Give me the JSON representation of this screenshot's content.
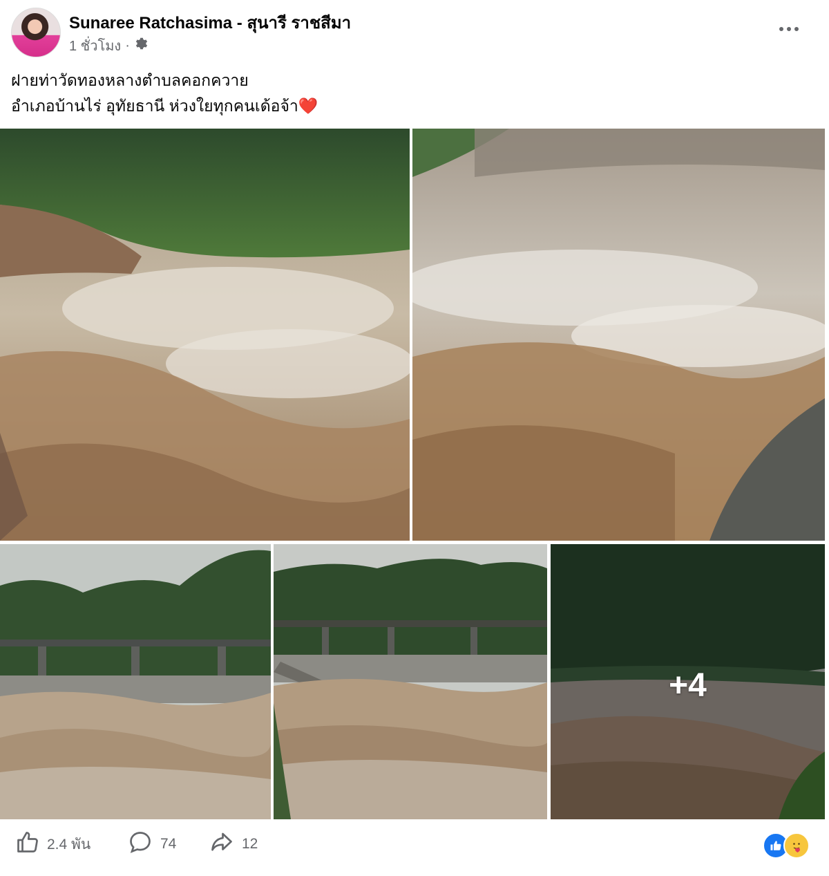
{
  "post": {
    "author": "Sunaree Ratchasima - สุนารี ราชสีมา",
    "time": "1 ชั่วโมง",
    "separator": "·",
    "caption_line1": "ฝายท่าวัดทองหลางตำบลคอกควาย",
    "caption_line2": "อำเภอบ้านไร่ อุทัยธานี ห่วงใยทุกคนเด้อจ้า",
    "caption_emoji": "❤️"
  },
  "gallery": {
    "more_count": "+4"
  },
  "stats": {
    "likes": "2.4 พัน",
    "comments": "74",
    "shares": "12"
  },
  "icons": {
    "audience": "settings-gear-icon",
    "more": "more-options-icon",
    "like": "thumbs-up-icon",
    "comment": "comment-bubble-icon",
    "share": "share-arrow-icon",
    "reaction1": "like-reaction-icon",
    "reaction2": "care-reaction-icon"
  },
  "colors": {
    "link_blue": "#1877f2",
    "secondary_text": "#65676b",
    "heart": "#e0245e"
  }
}
